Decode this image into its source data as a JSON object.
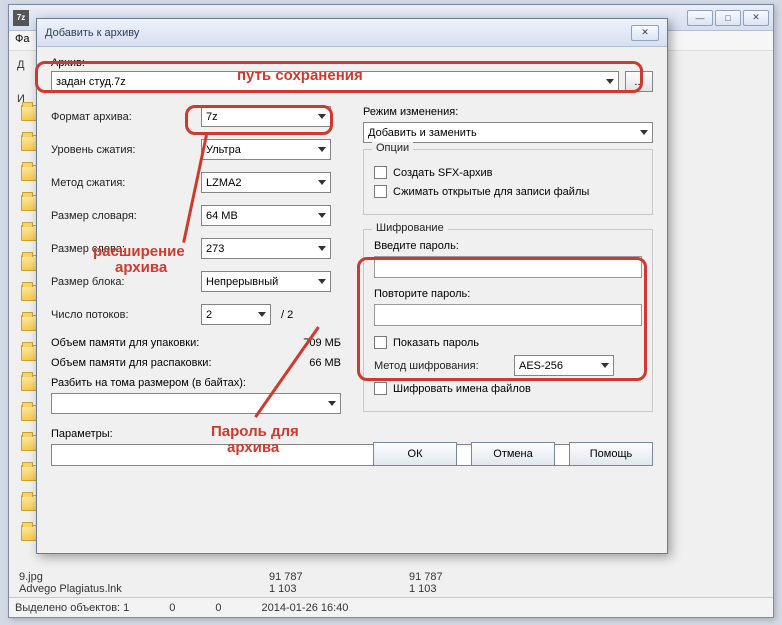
{
  "main": {
    "app_icon": "7z",
    "menu_file": "Фа",
    "cols": [
      "Д",
      "И"
    ]
  },
  "dialog": {
    "title": "Добавить к архиву",
    "archive_label": "Архив:",
    "archive_value": "задан студ.7z",
    "browse": "...",
    "left": {
      "format_label": "Формат архива:",
      "format_value": "7z",
      "level_label": "Уровень сжатия:",
      "level_value": "Ультра",
      "method_label": "Метод сжатия:",
      "method_value": "LZMA2",
      "dict_label": "Размер словаря:",
      "dict_value": "64 MB",
      "word_label": "Размер слова:",
      "word_value": "273",
      "block_label": "Размер блока:",
      "block_value": "Непрерывный",
      "threads_label": "Число потоков:",
      "threads_value": "2",
      "threads_max": "/ 2",
      "mem_pack_label": "Объем памяти для упаковки:",
      "mem_pack_value": "709 МБ",
      "mem_unpack_label": "Объем памяти для распаковки:",
      "mem_unpack_value": "66 MB",
      "split_label": "Разбить на тома размером (в байтах):",
      "params_label": "Параметры:"
    },
    "right": {
      "update_label": "Режим изменения:",
      "update_value": "Добавить и заменить",
      "options_title": "Опции",
      "sfx_label": "Создать SFX-архив",
      "compress_open_label": "Сжимать открытые для записи файлы",
      "enc_title": "Шифрование",
      "pw1_label": "Введите пароль:",
      "pw2_label": "Повторите пароль:",
      "show_pw_label": "Показать пароль",
      "enc_method_label": "Метод шифрования:",
      "enc_method_value": "AES-256",
      "enc_names_label": "Шифровать имена файлов"
    },
    "buttons": {
      "ok": "ОК",
      "cancel": "Отмена",
      "help": "Помощь"
    }
  },
  "annotations": {
    "path": "путь сохранения",
    "ext1": "расширение",
    "ext2": "архива",
    "pw1": "Пароль для",
    "pw2": "архива"
  },
  "bg_files": {
    "r1": {
      "name": "9.jpg",
      "s1": "91 787",
      "s2": "91 787"
    },
    "r2": {
      "name": "Advego Plagiatus.lnk",
      "s1": "1 103",
      "s2": "1 103"
    }
  },
  "status": {
    "sel": "Выделено объектов: 1",
    "c1": "0",
    "c2": "0",
    "date": "2014-01-26 16:40"
  }
}
